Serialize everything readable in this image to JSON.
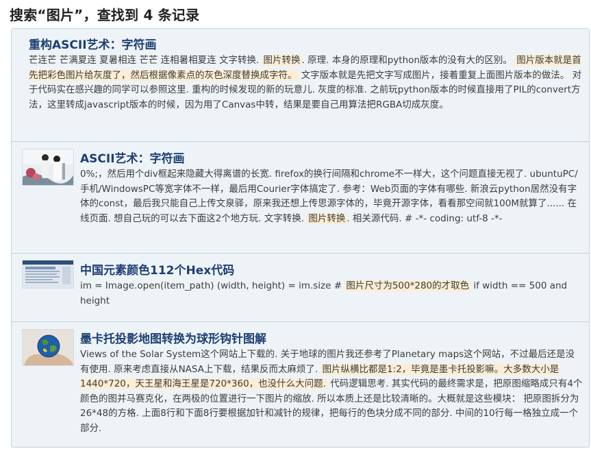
{
  "page": {
    "heading": "搜索“图片”，查找到 4 条记录"
  },
  "results": [
    {
      "title": "重构ASCII艺术：字符画",
      "snippet": [
        {
          "t": "芒连芒 芒满夏连 夏暑相连 芒芒 连相暑相夏连 文字转换. ",
          "h": false
        },
        {
          "t": "图片转换",
          "h": true
        },
        {
          "t": ". 原理. 本身的原理和python版本的没有大的区别。 ",
          "h": false
        },
        {
          "t": "图片版本就是首先把彩色图片给灰度了，然后根据像素点的灰色深度替换成字符。",
          "h": true
        },
        {
          "t": " 文字版本就是先把文字写成图片，接着重复上面图片版本的做法。 对于代码实在感兴趣的同学可以参照这里. 重构的时候发现的新的玩意儿. 灰度的标准. 之前玩python版本的时候直接用了PIL的convert方法，这里转成javascript版本的时候，因为用了Canvas中转，结果是要自己用算法把RGBA切成灰度。",
          "h": false
        }
      ]
    },
    {
      "title": "ASCII艺术：字符画",
      "thumb": "portrait-photo",
      "snippet": [
        {
          "t": "0%;，然后用个div框起来隐藏大得离谱的长宽. firefox的换行间隔和chrome不一样大，这个问题直接无视了. ubuntuPC/手机/WindowsPC等宽字体不一样，最后用Courier字体搞定了. 参考：Web页面的字体有哪些. 新浪云python居然没有字体的const，最后我只能自己上传文泉驿，原来我还想上传思源字体的，毕竟开源字体，看看那空间就100M就算了...... 在线页面. 想自己玩的可以去下面这2个地方玩. 文字转换. ",
          "h": false
        },
        {
          "t": "图片转换",
          "h": true
        },
        {
          "t": ". 相关源代码. # -*- coding: utf-8 -*-",
          "h": false
        }
      ]
    },
    {
      "title": "中国元素颜色112个Hex代码",
      "thumb": "webpage-screenshot",
      "snippet": [
        {
          "t": "im = Image.open(item_path) (width, height) = im.size # ",
          "h": false
        },
        {
          "t": "图片尺寸为500*280的才取色",
          "h": true
        },
        {
          "t": " if width == 500 and height",
          "h": false
        }
      ]
    },
    {
      "title": "墨卡托投影地图转换为球形钩针图解",
      "thumb": "globe-in-hand-photo",
      "snippet": [
        {
          "t": "Views of the Solar System这个网站上下载的. 关于地球的图片我还参考了Planetary maps这个网站，不过最后还是没有使用. 原来考虑直接从NASA上下载，结果反而太麻烦了. ",
          "h": false
        },
        {
          "t": "图片纵横比都是1:2，毕竟是墨卡托投影嘛。大多数大小是1440*720，天王星和海王星是720*360，也没什么大问题.",
          "h": true
        },
        {
          "t": " 代码逻辑思考. 其实代码的最终需求是，把原图缩略成只有4个颜色的图并马赛克化，在两极的位置进行一下图片的缩放. 所以本质上还是比较清晰的。大概就是这些模块： 把原图拆分为26*48的方格. 上面8行和下面8行要根据加针和减针的规律，把每行的色块分成不同的部分. 中间的10行每一格独立成一个部分.",
          "h": false
        }
      ]
    }
  ]
}
